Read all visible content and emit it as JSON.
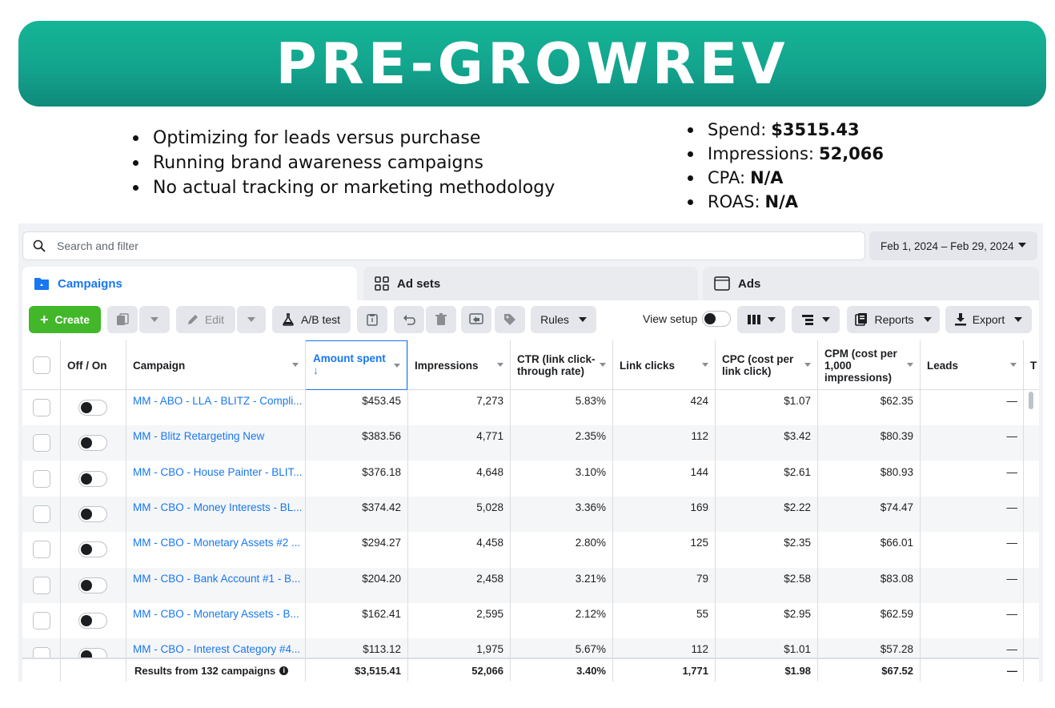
{
  "banner": {
    "title": "PRE-GROWREV"
  },
  "left_bullets": [
    "Optimizing for leads versus purchase",
    "Running brand awareness campaigns",
    "No actual tracking or marketing methodology"
  ],
  "right_bullets": [
    {
      "label": "Spend:",
      "value": "$3515.43"
    },
    {
      "label": "Impressions:",
      "value": "52,066"
    },
    {
      "label": "CPA:",
      "value": "N/A"
    },
    {
      "label": "ROAS:",
      "value": "N/A"
    }
  ],
  "search": {
    "placeholder": "Search and filter"
  },
  "date_range": "Feb 1, 2024 – Feb 29, 2024",
  "tabs": {
    "campaigns": "Campaigns",
    "ad_sets": "Ad sets",
    "ads": "Ads"
  },
  "toolbar": {
    "create": "Create",
    "edit": "Edit",
    "ab_test": "A/B test",
    "rules": "Rules",
    "view_setup": "View setup",
    "reports": "Reports",
    "export": "Export"
  },
  "columns": {
    "off_on": "Off / On",
    "campaign": "Campaign",
    "amount_spent": "Amount spent",
    "amount_arrow": "↓",
    "impressions": "Impressions",
    "ctr": "CTR (link click-through rate)",
    "link_clicks": "Link clicks",
    "cpc": "CPC (cost per link click)",
    "cpm": "CPM (cost per 1,000 impressions)",
    "leads": "Leads",
    "next": "T"
  },
  "rows": [
    {
      "campaign": "MM - ABO - LLA - BLITZ - Compli...",
      "spent": "$453.45",
      "impressions": "7,273",
      "ctr": "5.83%",
      "clicks": "424",
      "cpc": "$1.07",
      "cpm": "$62.35",
      "leads": "—"
    },
    {
      "campaign": "MM - Blitz Retargeting New",
      "spent": "$383.56",
      "impressions": "4,771",
      "ctr": "2.35%",
      "clicks": "112",
      "cpc": "$3.42",
      "cpm": "$80.39",
      "leads": "—"
    },
    {
      "campaign": "MM - CBO - House Painter - BLIT...",
      "spent": "$376.18",
      "impressions": "4,648",
      "ctr": "3.10%",
      "clicks": "144",
      "cpc": "$2.61",
      "cpm": "$80.93",
      "leads": "—"
    },
    {
      "campaign": "MM - CBO - Money Interests - BL...",
      "spent": "$374.42",
      "impressions": "5,028",
      "ctr": "3.36%",
      "clicks": "169",
      "cpc": "$2.22",
      "cpm": "$74.47",
      "leads": "—"
    },
    {
      "campaign": "MM - CBO - Monetary Assets #2 ...",
      "spent": "$294.27",
      "impressions": "4,458",
      "ctr": "2.80%",
      "clicks": "125",
      "cpc": "$2.35",
      "cpm": "$66.01",
      "leads": "—"
    },
    {
      "campaign": "MM - CBO - Bank Account #1 - B...",
      "spent": "$204.20",
      "impressions": "2,458",
      "ctr": "3.21%",
      "clicks": "79",
      "cpc": "$2.58",
      "cpm": "$83.08",
      "leads": "—"
    },
    {
      "campaign": "MM - CBO - Monetary Assets - B...",
      "spent": "$162.41",
      "impressions": "2,595",
      "ctr": "2.12%",
      "clicks": "55",
      "cpc": "$2.95",
      "cpm": "$62.59",
      "leads": "—"
    },
    {
      "campaign": "MM - CBO - Interest Category #4...",
      "spent": "$113.12",
      "impressions": "1,975",
      "ctr": "5.67%",
      "clicks": "112",
      "cpc": "$1.01",
      "cpm": "$57.28",
      "leads": "—"
    }
  ],
  "totals": {
    "label": "Results from 132 campaigns",
    "info": "i",
    "spent": "$3,515.41",
    "impressions": "52,066",
    "ctr": "3.40%",
    "clicks": "1,771",
    "cpc": "$1.98",
    "cpm": "$67.52",
    "leads": "—"
  },
  "colors": {
    "banner": "#13a48d",
    "accent": "#1877f2",
    "create": "#42b72a"
  }
}
